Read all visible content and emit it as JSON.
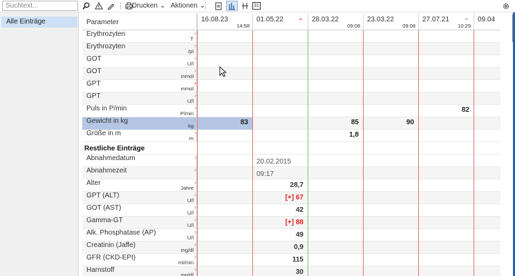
{
  "toolbar": {
    "search_placeholder": "Suchtext...",
    "print_label": "Drucken",
    "actions_label": "Aktionen",
    "calendar_label": "31",
    "icons": [
      "search-icon",
      "warning-icon",
      "pen-icon",
      "print-icon",
      "document-icon",
      "chart-icon",
      "columns-icon",
      "calendar-icon",
      "settings-icon"
    ]
  },
  "sidebar": {
    "items": [
      {
        "label": "Alle Einträge"
      }
    ]
  },
  "grid": {
    "param_header": "Parameter",
    "columns": [
      {
        "date": "16.08.23",
        "time": "14:58"
      },
      {
        "date": "01.05.22",
        "time": ""
      },
      {
        "date": "28.03.22",
        "time": "09:08"
      },
      {
        "date": "23.03.22",
        "time": "09:08"
      },
      {
        "date": "27.07.21",
        "time": "10:29"
      },
      {
        "date": "09.04",
        "time": ""
      }
    ],
    "rows": [
      {
        "name": "Erythrozyten",
        "unit": "T",
        "values": [
          "",
          "",
          "",
          "",
          "",
          ""
        ]
      },
      {
        "name": "Erythrozyten",
        "unit": "/pl",
        "values": [
          "",
          "",
          "",
          "",
          "",
          ""
        ]
      },
      {
        "name": "GOT",
        "unit": "U/l",
        "values": [
          "",
          "",
          "",
          "",
          "",
          ""
        ]
      },
      {
        "name": "GOT",
        "unit": "mmol",
        "values": [
          "",
          "",
          "",
          "",
          "",
          ""
        ]
      },
      {
        "name": "GPT",
        "unit": "mmol",
        "values": [
          "",
          "",
          "",
          "",
          "",
          ""
        ]
      },
      {
        "name": "GPT",
        "unit": "U/l",
        "values": [
          "",
          "",
          "",
          "",
          "",
          ""
        ]
      },
      {
        "name": "Puls in P/min",
        "unit": "P/min",
        "values": [
          "",
          "",
          "",
          "",
          "82",
          ""
        ]
      },
      {
        "name": "Gewicht in kg",
        "unit": "kg",
        "values": [
          "83",
          "",
          "85",
          "90",
          "",
          ""
        ]
      },
      {
        "name": "Größe in m",
        "unit": "m",
        "values": [
          "",
          "",
          "1,8",
          "",
          "",
          ""
        ]
      }
    ],
    "section_title": "Restliche Einträge",
    "rest_rows": [
      {
        "name": "Abnahmedatum",
        "unit": "",
        "value": "20.02.2015"
      },
      {
        "name": "Abnahmezeit",
        "unit": "",
        "value": "09:17"
      },
      {
        "name": "Alter",
        "unit": "Jahre",
        "value": "28,7"
      },
      {
        "name": "GPT (ALT)",
        "unit": "U/l",
        "value": "[+] 67"
      },
      {
        "name": "GOT (AST)",
        "unit": "U/l",
        "value": "42"
      },
      {
        "name": "Gamma-GT",
        "unit": "U/l",
        "value": "[+] 88"
      },
      {
        "name": "Alk. Phosphatase (AP)",
        "unit": "U/l",
        "value": "49"
      },
      {
        "name": "Creatinin (Jaffe)",
        "unit": "mg/dl",
        "value": "0,9"
      },
      {
        "name": "GFR (CKD-EPI)",
        "unit": "ml/min",
        "value": "115"
      },
      {
        "name": "Harnstoff",
        "unit": "mg/dl",
        "value": "30"
      }
    ]
  },
  "colors": {
    "highlight": "#b4c6e3",
    "red_line": "#e07070",
    "green_line": "#80c080",
    "flag": "#e02020",
    "accent": "#2b5fb0"
  }
}
